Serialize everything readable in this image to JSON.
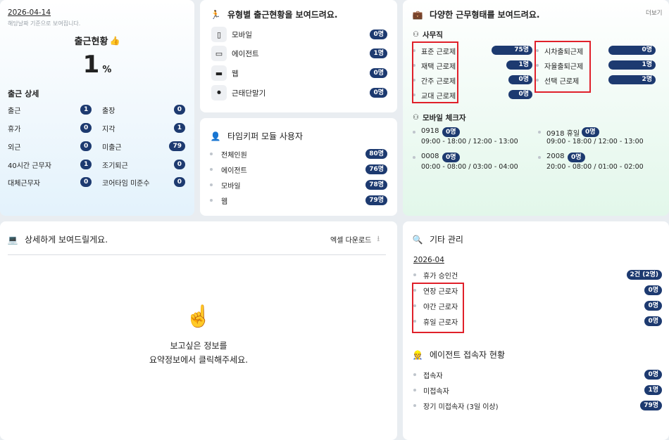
{
  "attendance": {
    "date": "2026-04-14",
    "note": "해당날짜 기준으로 보여집니다.",
    "title": "출근현황",
    "percent": "1",
    "percent_unit": "%",
    "detail_title": "출근 상세",
    "left_items": [
      {
        "label": "출근",
        "count": "1"
      },
      {
        "label": "휴가",
        "count": "0"
      },
      {
        "label": "외근",
        "count": "0"
      },
      {
        "label": "40시간 근무자",
        "count": "1"
      },
      {
        "label": "대체근무자",
        "count": "0"
      }
    ],
    "right_items": [
      {
        "label": "출장",
        "count": "0"
      },
      {
        "label": "지각",
        "count": "1"
      },
      {
        "label": "미출근",
        "count": "79"
      },
      {
        "label": "조기퇴근",
        "count": "0"
      },
      {
        "label": "코어타임 미준수",
        "count": "0"
      }
    ]
  },
  "type_status": {
    "title": "유형별 출근현황을 보여드려요.",
    "items": [
      {
        "label": "모바일",
        "count": "0명",
        "icon": "mobile-icon"
      },
      {
        "label": "에이전트",
        "count": "1명",
        "icon": "agent-icon"
      },
      {
        "label": "웹",
        "count": "0명",
        "icon": "web-icon"
      },
      {
        "label": "근태단말기",
        "count": "0명",
        "icon": "terminal-icon"
      }
    ]
  },
  "timekeeper": {
    "title": "타임키퍼 모듈 사용자",
    "items": [
      {
        "label": "전체인원",
        "count": "80명"
      },
      {
        "label": "에이전트",
        "count": "76명"
      },
      {
        "label": "모바일",
        "count": "78명"
      },
      {
        "label": "웹",
        "count": "79명"
      }
    ]
  },
  "work_types": {
    "title": "다양한 근무형태를 보여드려요.",
    "more": "더보기",
    "office_title": "사무직",
    "left": [
      {
        "label": "표준 근로제",
        "count": "75명",
        "fill": 0.94
      },
      {
        "label": "재택 근로제",
        "count": "1명",
        "fill": 0.6
      },
      {
        "label": "간주 근로제",
        "count": "0명",
        "fill": 0.55
      },
      {
        "label": "교대 근로제",
        "count": "0명",
        "fill": 0.55
      }
    ],
    "right": [
      {
        "label": "시차출퇴근제",
        "count": "0명",
        "fill": 0.58
      },
      {
        "label": "자율출퇴근제",
        "count": "1명",
        "fill": 0.58
      },
      {
        "label": "선택 근로제",
        "count": "2명",
        "fill": 0.58
      }
    ],
    "mobile_title": "모바일 체크자",
    "mobile": [
      {
        "code": "0918",
        "badge": "0명",
        "time": "09:00 - 18:00 / 12:00 - 13:00"
      },
      {
        "code": "0918 휴일",
        "badge": "0명",
        "time": "09:00 - 18:00 / 12:00 - 13:00"
      },
      {
        "code": "0008",
        "badge": "0명",
        "time": "00:00 - 08:00 / 03:00 - 04:00"
      },
      {
        "code": "2008",
        "badge": "0명",
        "time": "20:00 - 08:00 / 01:00 - 02:00"
      }
    ]
  },
  "detail": {
    "title": "상세하게 보여드릴게요.",
    "excel": "엑셀 다운로드",
    "empty_line1": "보고싶은 정보를",
    "empty_line2": "요약정보에서 클릭해주세요."
  },
  "etc": {
    "title": "기타 관리",
    "month": "2026-04",
    "items": [
      {
        "label": "휴가 승인건",
        "count": "2건 (2명)"
      },
      {
        "label": "연장 근로자",
        "count": "0명"
      },
      {
        "label": "야간 근로자",
        "count": "0명"
      },
      {
        "label": "휴일 근로자",
        "count": "0명"
      }
    ],
    "agent_title": "에이전트 접속자 현황",
    "agent_items": [
      {
        "label": "접속자",
        "count": "0명"
      },
      {
        "label": "미접속자",
        "count": "1명"
      },
      {
        "label": "장기 미접속자 (3일 이상)",
        "count": "79명"
      }
    ]
  }
}
